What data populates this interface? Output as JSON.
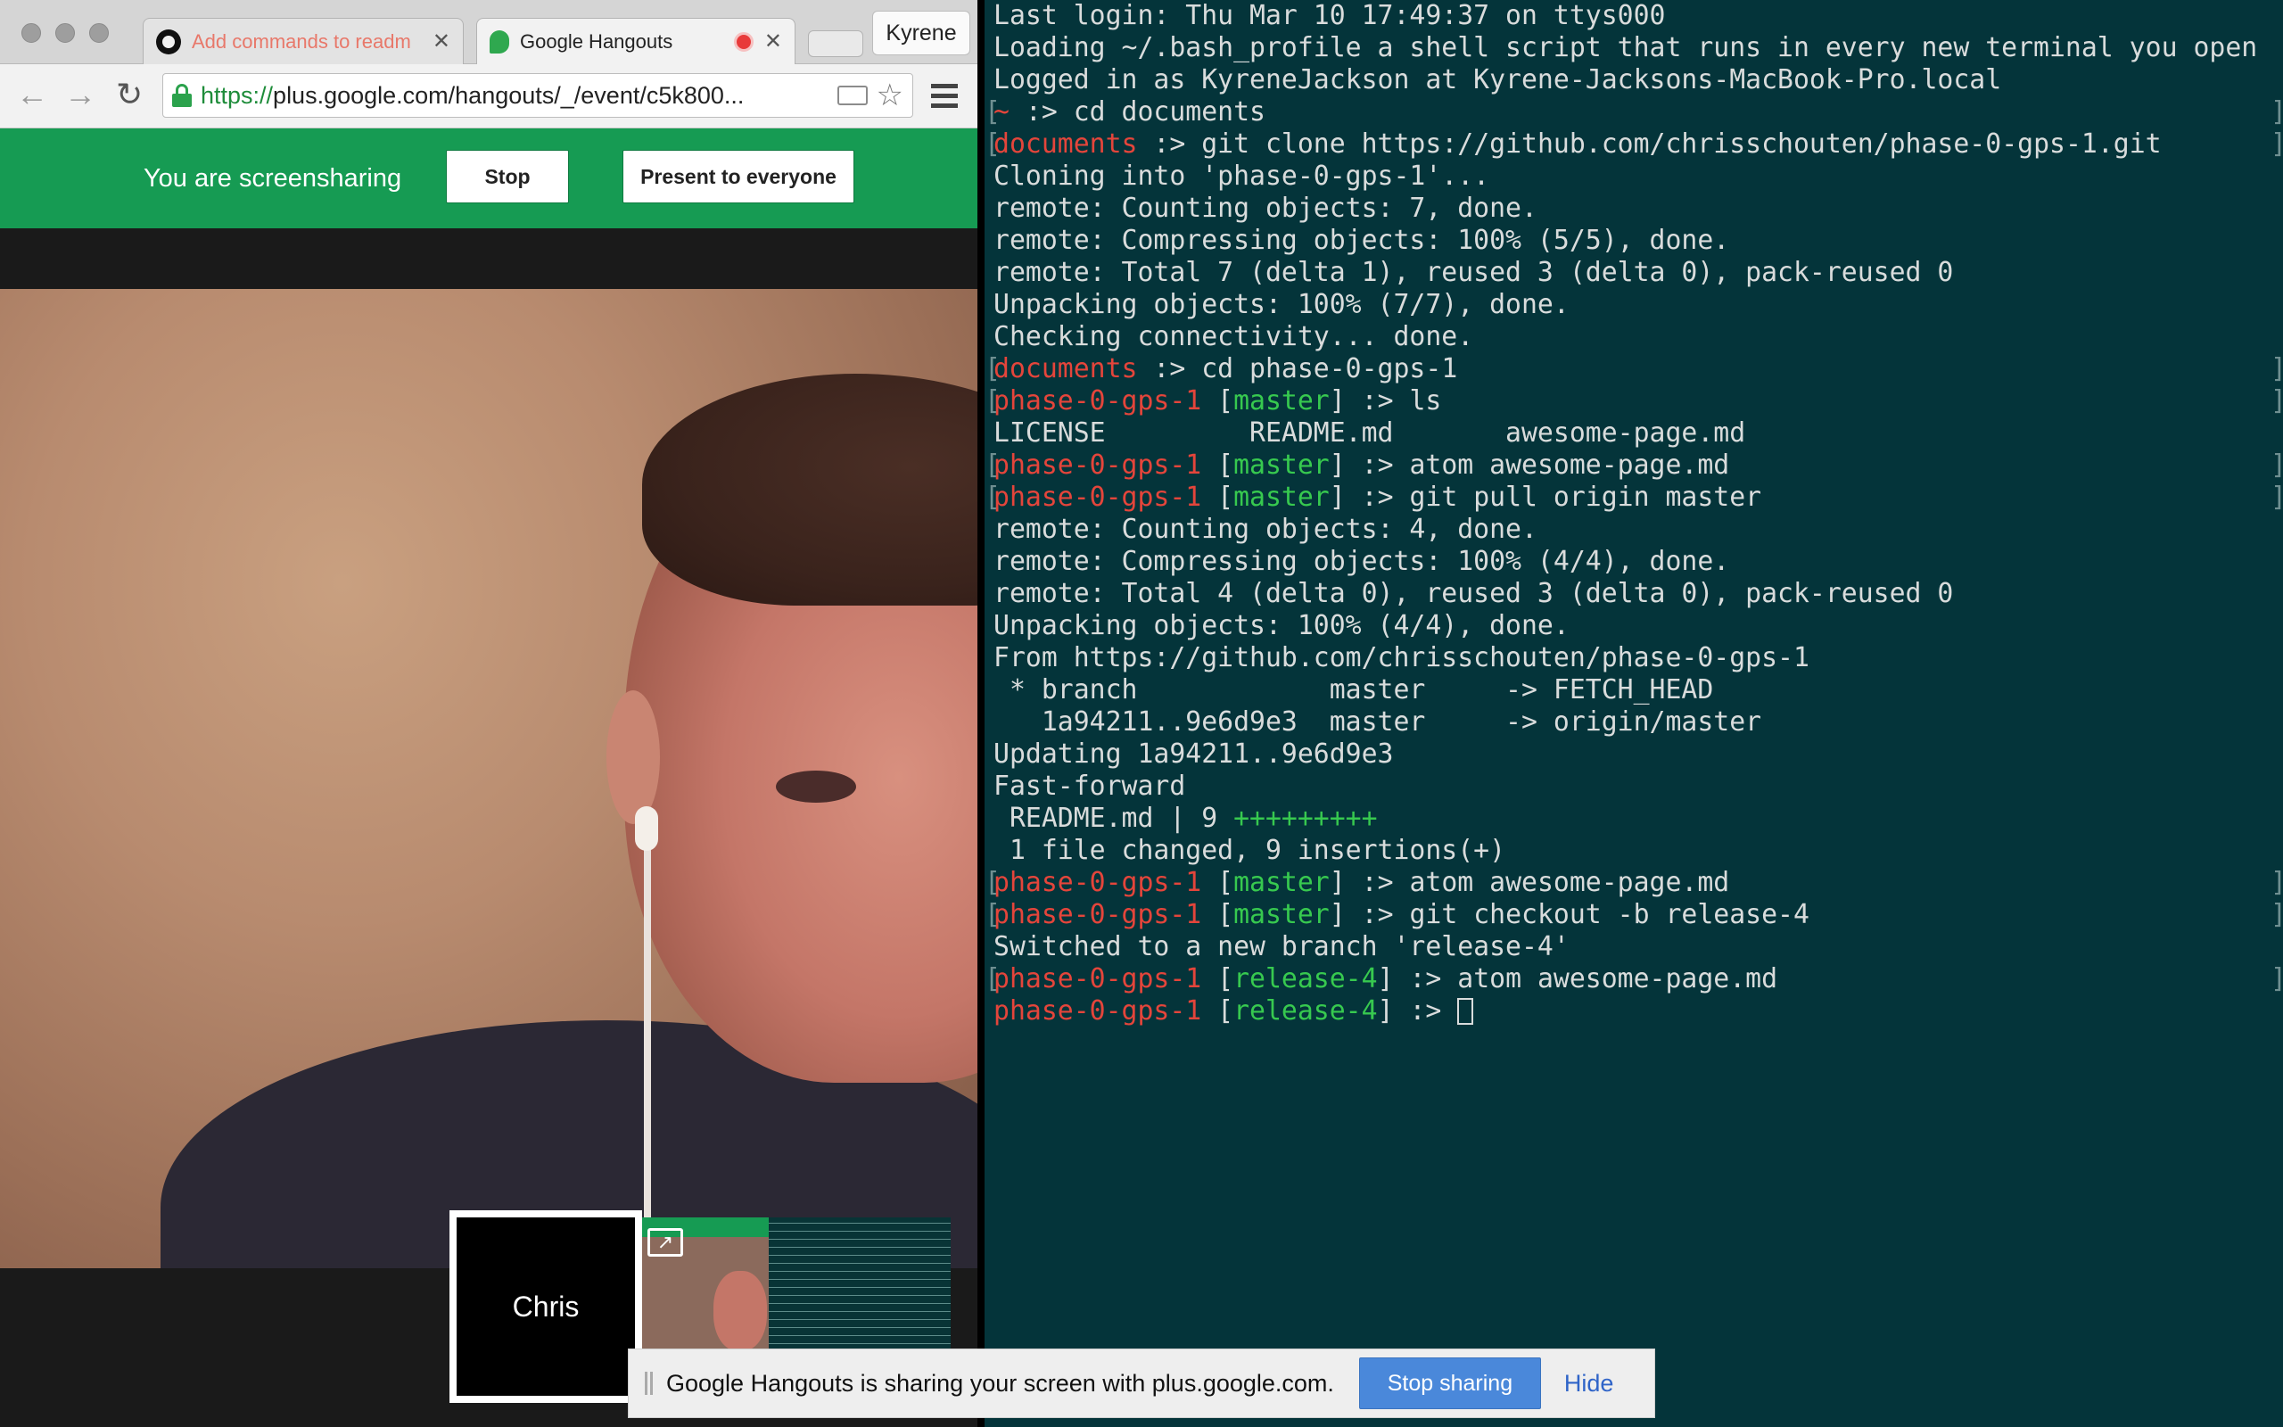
{
  "browser": {
    "tabs": [
      {
        "title": "Add commands to readm",
        "icon": "github-icon",
        "active": false
      },
      {
        "title": "Google Hangouts",
        "icon": "hangouts-icon",
        "active": true,
        "recording": true
      }
    ],
    "profile_name": "Kyrene",
    "url_scheme": "https://",
    "url_rest": "plus.google.com/hangouts/_/event/c5k800..."
  },
  "hangout": {
    "banner_text": "You are screensharing",
    "stop_label": "Stop",
    "present_label": "Present to everyone",
    "self_tile_name": "Chris",
    "accent_green": "#169b53"
  },
  "terminal": {
    "lines": [
      {
        "segments": [
          {
            "t": "Last login: Thu Mar 10 17:49:37 on ttys000",
            "c": ""
          }
        ]
      },
      {
        "segments": [
          {
            "t": "Loading ~/.bash_profile a shell script that runs in every new terminal you open",
            "c": ""
          }
        ]
      },
      {
        "segments": [
          {
            "t": "Logged in as KyreneJackson at Kyrene-Jacksons-MacBook-Pro.local",
            "c": ""
          }
        ]
      },
      {
        "prompt": true,
        "segments": [
          {
            "t": "~",
            "c": "red"
          },
          {
            "t": " :> cd documents",
            "c": ""
          }
        ]
      },
      {
        "prompt": true,
        "segments": [
          {
            "t": "documents",
            "c": "red"
          },
          {
            "t": " :> git clone https://github.com/chrisschouten/phase-0-gps-1.git",
            "c": ""
          }
        ]
      },
      {
        "segments": [
          {
            "t": "Cloning into 'phase-0-gps-1'...",
            "c": ""
          }
        ]
      },
      {
        "segments": [
          {
            "t": "remote: Counting objects: 7, done.",
            "c": ""
          }
        ]
      },
      {
        "segments": [
          {
            "t": "remote: Compressing objects: 100% (5/5), done.",
            "c": ""
          }
        ]
      },
      {
        "segments": [
          {
            "t": "remote: Total 7 (delta 1), reused 3 (delta 0), pack-reused 0",
            "c": ""
          }
        ]
      },
      {
        "segments": [
          {
            "t": "Unpacking objects: 100% (7/7), done.",
            "c": ""
          }
        ]
      },
      {
        "segments": [
          {
            "t": "Checking connectivity... done.",
            "c": ""
          }
        ]
      },
      {
        "prompt": true,
        "segments": [
          {
            "t": "documents",
            "c": "red"
          },
          {
            "t": " :> cd phase-0-gps-1",
            "c": ""
          }
        ]
      },
      {
        "prompt": true,
        "segments": [
          {
            "t": "phase-0-gps-1",
            "c": "red"
          },
          {
            "t": " [",
            "c": ""
          },
          {
            "t": "master",
            "c": "green"
          },
          {
            "t": "] :> ls",
            "c": ""
          }
        ]
      },
      {
        "segments": [
          {
            "t": "LICENSE         README.md       awesome-page.md",
            "c": ""
          }
        ]
      },
      {
        "prompt": true,
        "segments": [
          {
            "t": "phase-0-gps-1",
            "c": "red"
          },
          {
            "t": " [",
            "c": ""
          },
          {
            "t": "master",
            "c": "green"
          },
          {
            "t": "] :> atom awesome-page.md",
            "c": ""
          }
        ]
      },
      {
        "prompt": true,
        "segments": [
          {
            "t": "phase-0-gps-1",
            "c": "red"
          },
          {
            "t": " [",
            "c": ""
          },
          {
            "t": "master",
            "c": "green"
          },
          {
            "t": "] :> git pull origin master",
            "c": ""
          }
        ]
      },
      {
        "segments": [
          {
            "t": "remote: Counting objects: 4, done.",
            "c": ""
          }
        ]
      },
      {
        "segments": [
          {
            "t": "remote: Compressing objects: 100% (4/4), done.",
            "c": ""
          }
        ]
      },
      {
        "segments": [
          {
            "t": "remote: Total 4 (delta 0), reused 3 (delta 0), pack-reused 0",
            "c": ""
          }
        ]
      },
      {
        "segments": [
          {
            "t": "Unpacking objects: 100% (4/4), done.",
            "c": ""
          }
        ]
      },
      {
        "segments": [
          {
            "t": "From https://github.com/chrisschouten/phase-0-gps-1",
            "c": ""
          }
        ]
      },
      {
        "segments": [
          {
            "t": " * branch            master     -> FETCH_HEAD",
            "c": ""
          }
        ]
      },
      {
        "segments": [
          {
            "t": "   1a94211..9e6d9e3  master     -> origin/master",
            "c": ""
          }
        ]
      },
      {
        "segments": [
          {
            "t": "Updating 1a94211..9e6d9e3",
            "c": ""
          }
        ]
      },
      {
        "segments": [
          {
            "t": "Fast-forward",
            "c": ""
          }
        ]
      },
      {
        "segments": [
          {
            "t": " README.md | 9 ",
            "c": ""
          },
          {
            "t": "+++++++++",
            "c": "green"
          }
        ]
      },
      {
        "segments": [
          {
            "t": " 1 file changed, 9 insertions(+)",
            "c": ""
          }
        ]
      },
      {
        "prompt": true,
        "segments": [
          {
            "t": "phase-0-gps-1",
            "c": "red"
          },
          {
            "t": " [",
            "c": ""
          },
          {
            "t": "master",
            "c": "green"
          },
          {
            "t": "] :> atom awesome-page.md",
            "c": ""
          }
        ]
      },
      {
        "prompt": true,
        "segments": [
          {
            "t": "phase-0-gps-1",
            "c": "red"
          },
          {
            "t": " [",
            "c": ""
          },
          {
            "t": "master",
            "c": "green"
          },
          {
            "t": "] :> git checkout -b release-4",
            "c": ""
          }
        ]
      },
      {
        "segments": [
          {
            "t": "Switched to a new branch 'release-4'",
            "c": ""
          }
        ]
      },
      {
        "prompt": true,
        "segments": [
          {
            "t": "phase-0-gps-1",
            "c": "red"
          },
          {
            "t": " [",
            "c": ""
          },
          {
            "t": "release-4",
            "c": "green"
          },
          {
            "t": "] :> atom awesome-page.md",
            "c": ""
          }
        ]
      },
      {
        "current": true,
        "segments": [
          {
            "t": "phase-0-gps-1",
            "c": "red"
          },
          {
            "t": " [",
            "c": ""
          },
          {
            "t": "release-4",
            "c": "green"
          },
          {
            "t": "] :> ",
            "c": ""
          }
        ]
      }
    ],
    "colors": {
      "background": "#04343a",
      "prompt_dir": "#e4453b",
      "branch": "#37c94f"
    }
  },
  "notification": {
    "text": "Google Hangouts is sharing your screen with plus.google.com.",
    "stop_sharing_label": "Stop sharing",
    "hide_label": "Hide"
  }
}
